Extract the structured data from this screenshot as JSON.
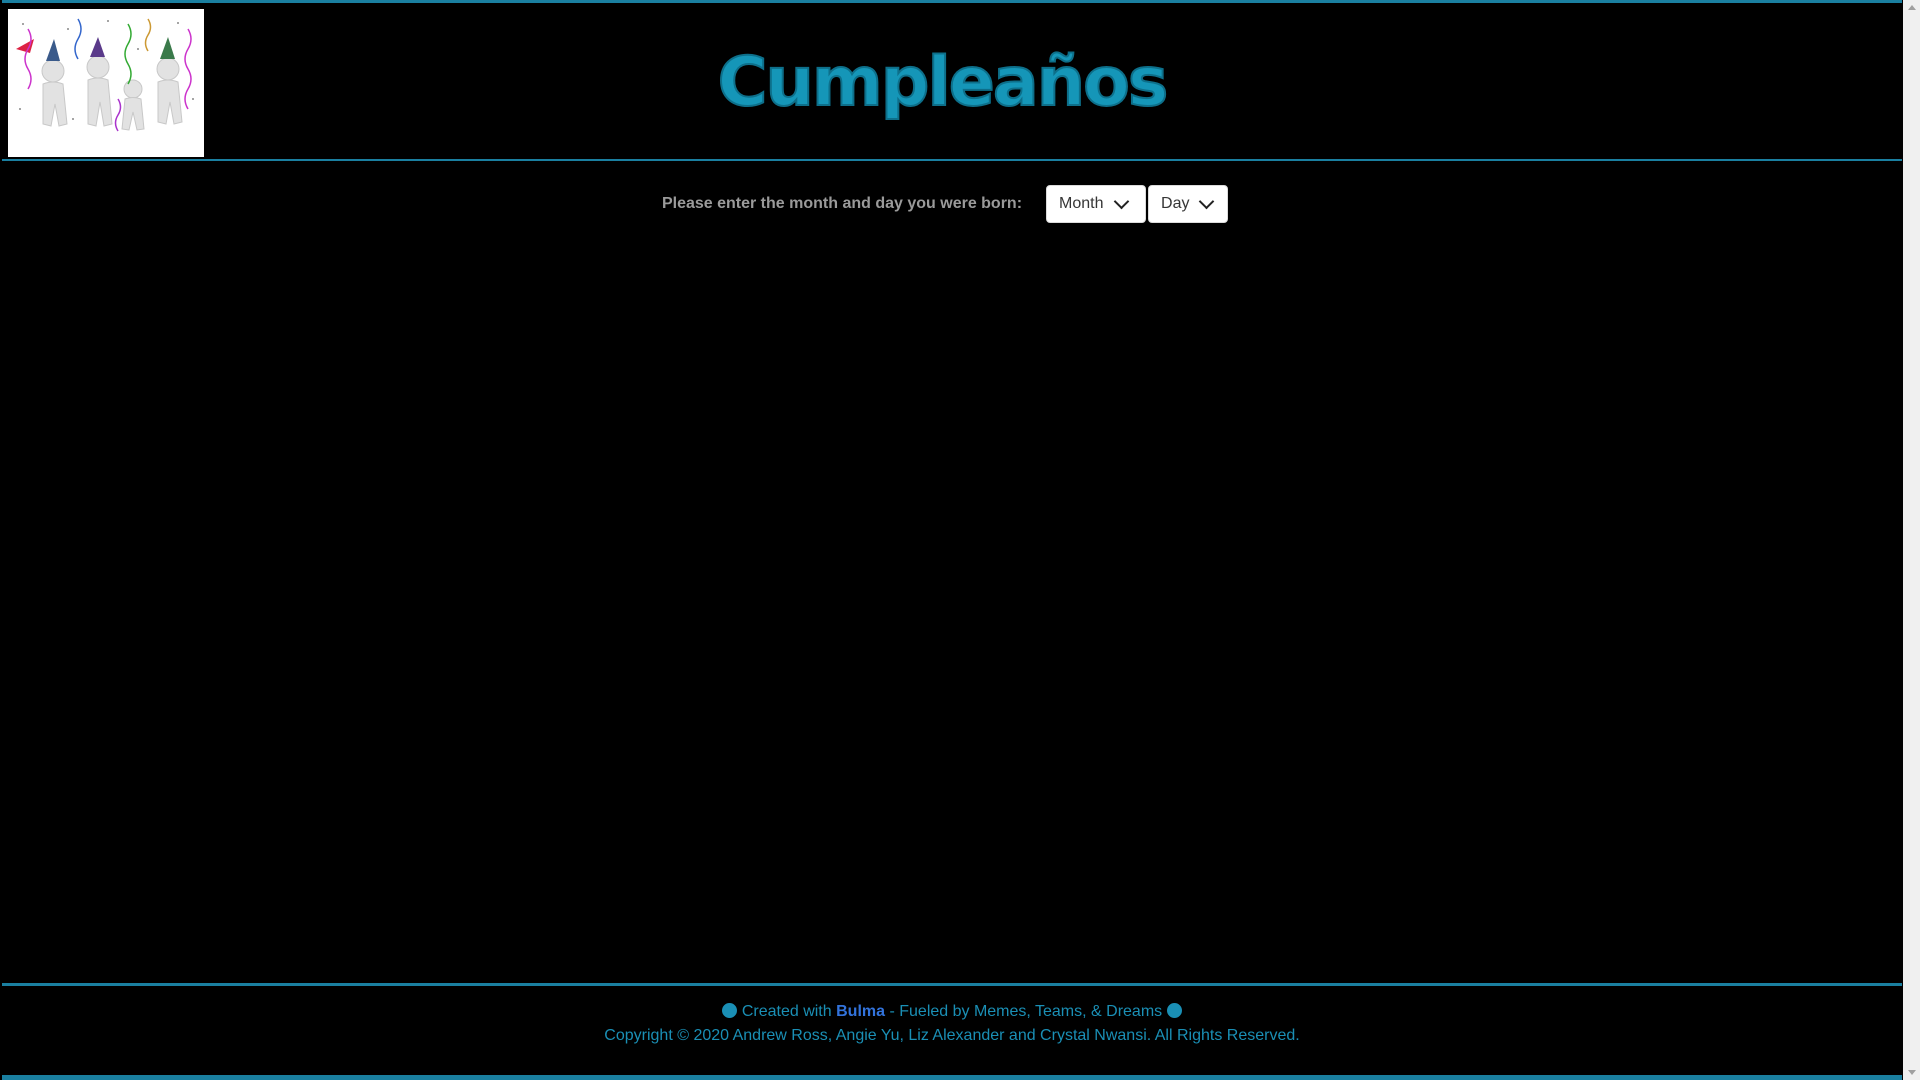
{
  "header": {
    "title": "Cumpleaños",
    "logo_alt": "party-people-image"
  },
  "form": {
    "prompt": "Please enter the month and day you were born:",
    "month_select": "Month",
    "day_select": "Day"
  },
  "footer": {
    "created_prefix": "Created with",
    "brand": "Bulma",
    "created_suffix": "- Fueled by Memes, Teams, & Dreams",
    "copyright": "Copyright © 2020 Andrew Ross, Angie Yu, Liz Alexander and Crystal Nwansi. All Rights Reserved."
  },
  "colors": {
    "accent": "#1a7fa0",
    "title": "#1596b8",
    "footer_text": "#1a8fb5",
    "brand_link": "#3273dc",
    "background": "#000000"
  },
  "icons": [
    "smiley-icon",
    "chevron-down-icon"
  ]
}
